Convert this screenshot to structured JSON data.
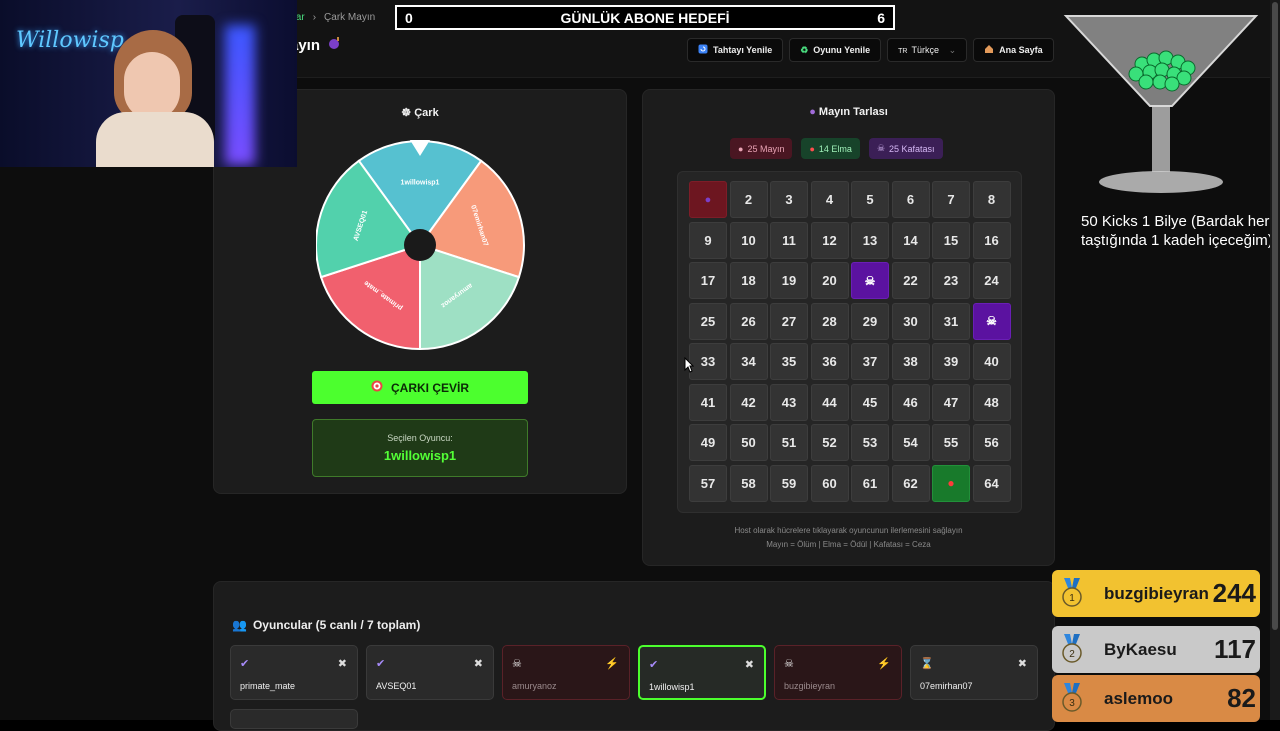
{
  "breadcrumb": {
    "prev": "nlar",
    "sep": "›",
    "current": "Çark Mayın"
  },
  "page_title": {
    "text": "ayın",
    "icon": "bomb-icon"
  },
  "goal_bar": {
    "left": "0",
    "title": "GÜNLÜK ABONE HEDEFİ",
    "right": "6"
  },
  "toolbar": {
    "refresh_board": "Tahtayı Yenile",
    "restart_game": "Oyunu Yenile",
    "language": "Türkçe",
    "language_flag": "TR",
    "home": "Ana Sayfa"
  },
  "wheel_panel": {
    "title": "Çark",
    "segments": [
      {
        "label": "1willowisp1",
        "color": "#56c1d0"
      },
      {
        "label": "07emirhan07",
        "color": "#f79a7a"
      },
      {
        "label": "amuryanoz",
        "color": "#9ee0c4"
      },
      {
        "label": "primate_mate",
        "color": "#f1606e"
      },
      {
        "label": "AVSEQ01",
        "color": "#52d1ac"
      }
    ],
    "spin_button": "ÇARKI ÇEVİR",
    "selected_label": "Seçilen Oyuncu:",
    "selected_value": "1willowisp1"
  },
  "mine_panel": {
    "title": "Mayın Tarlası",
    "pills": {
      "mines": "25 Mayın",
      "apples": "14 Elma",
      "skulls": "25 Kafatası"
    },
    "cells": [
      {
        "n": "1",
        "state": "mine"
      },
      {
        "n": "2"
      },
      {
        "n": "3"
      },
      {
        "n": "4"
      },
      {
        "n": "5"
      },
      {
        "n": "6"
      },
      {
        "n": "7"
      },
      {
        "n": "8"
      },
      {
        "n": "9"
      },
      {
        "n": "10"
      },
      {
        "n": "11"
      },
      {
        "n": "12"
      },
      {
        "n": "13"
      },
      {
        "n": "14"
      },
      {
        "n": "15"
      },
      {
        "n": "16"
      },
      {
        "n": "17"
      },
      {
        "n": "18"
      },
      {
        "n": "19"
      },
      {
        "n": "20"
      },
      {
        "n": "21",
        "state": "skull"
      },
      {
        "n": "22"
      },
      {
        "n": "23"
      },
      {
        "n": "24"
      },
      {
        "n": "25"
      },
      {
        "n": "26"
      },
      {
        "n": "27"
      },
      {
        "n": "28"
      },
      {
        "n": "29"
      },
      {
        "n": "30"
      },
      {
        "n": "31"
      },
      {
        "n": "32",
        "state": "skull"
      },
      {
        "n": "33"
      },
      {
        "n": "34"
      },
      {
        "n": "35"
      },
      {
        "n": "36"
      },
      {
        "n": "37"
      },
      {
        "n": "38"
      },
      {
        "n": "39"
      },
      {
        "n": "40"
      },
      {
        "n": "41"
      },
      {
        "n": "42"
      },
      {
        "n": "43"
      },
      {
        "n": "44"
      },
      {
        "n": "45"
      },
      {
        "n": "46"
      },
      {
        "n": "47"
      },
      {
        "n": "48"
      },
      {
        "n": "49"
      },
      {
        "n": "50"
      },
      {
        "n": "51"
      },
      {
        "n": "52"
      },
      {
        "n": "53"
      },
      {
        "n": "54"
      },
      {
        "n": "55"
      },
      {
        "n": "56"
      },
      {
        "n": "57"
      },
      {
        "n": "58"
      },
      {
        "n": "59"
      },
      {
        "n": "60"
      },
      {
        "n": "61"
      },
      {
        "n": "62"
      },
      {
        "n": "63",
        "state": "apple"
      },
      {
        "n": "64"
      }
    ],
    "note_line1": "Host olarak hücrelere tıklayarak oyuncunun ilerlemesini sağlayın",
    "note_line2": "Mayın = Ölüm | Elma = Ödül | Kafatası = Ceza"
  },
  "players": {
    "title": "Oyuncular (5 canlı / 7 toplam)",
    "list": [
      {
        "name": "primate_mate",
        "status": "alive"
      },
      {
        "name": "AVSEQ01",
        "status": "alive"
      },
      {
        "name": "amuryanoz",
        "status": "dead"
      },
      {
        "name": "1willowisp1",
        "status": "selected"
      },
      {
        "name": "buzgibieyran",
        "status": "dead"
      },
      {
        "name": "07emirhan07",
        "status": "waiting"
      }
    ]
  },
  "overlay": {
    "kicks_text": "50 Kicks 1 Bilye (Bardak her taştığında 1 kadeh içeceğim)",
    "leaderboard": [
      {
        "rank": "1",
        "name": "buzgibieyran",
        "score": "244",
        "color": "#f2c230"
      },
      {
        "rank": "2",
        "name": "ByKaesu",
        "score": "117",
        "color": "#c9c9c9"
      },
      {
        "rank": "3",
        "name": "aslemoo",
        "score": "82",
        "color": "#d98a45"
      }
    ],
    "cam_logo": "Willowisp"
  }
}
